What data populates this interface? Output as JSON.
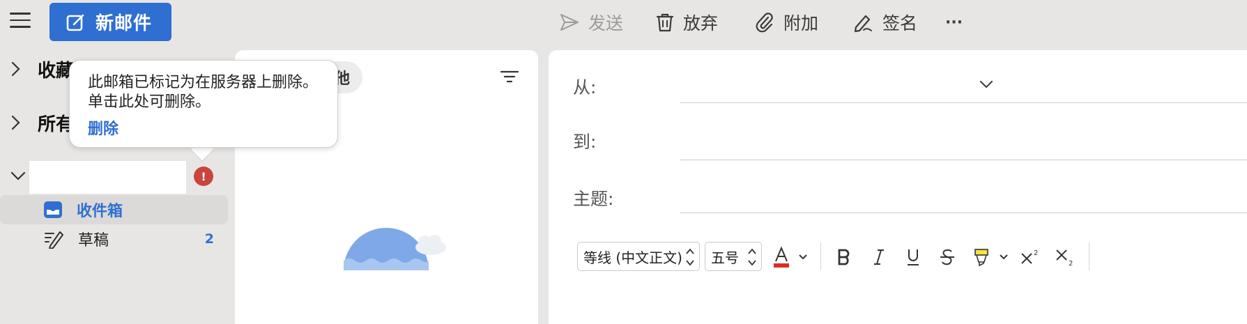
{
  "toolbar": {
    "new_mail_label": "新邮件",
    "send_label": "发送",
    "discard_label": "放弃",
    "attach_label": "附加",
    "signature_label": "签名",
    "more_label": "···"
  },
  "sidebar": {
    "favorites_label": "收藏",
    "all_accounts_label": "所有",
    "folders": [
      {
        "label": "收件箱",
        "count": ""
      },
      {
        "label": "草稿",
        "count": "2"
      }
    ],
    "error_badge": "!"
  },
  "tooltip": {
    "message": "此邮箱已标记为在服务器上删除。单击此处可删除。",
    "action_label": "删除"
  },
  "message_list": {
    "other_tab_label": "他"
  },
  "compose": {
    "from_label": "从:",
    "to_label": "到:",
    "subject_label": "主题:",
    "font_family": "等线 (中文正文)",
    "font_size": "五号"
  },
  "colors": {
    "accent": "#2f6fd1",
    "error": "#c9453f",
    "font_color_bar": "#d93025",
    "highlight": "#f5e342"
  }
}
